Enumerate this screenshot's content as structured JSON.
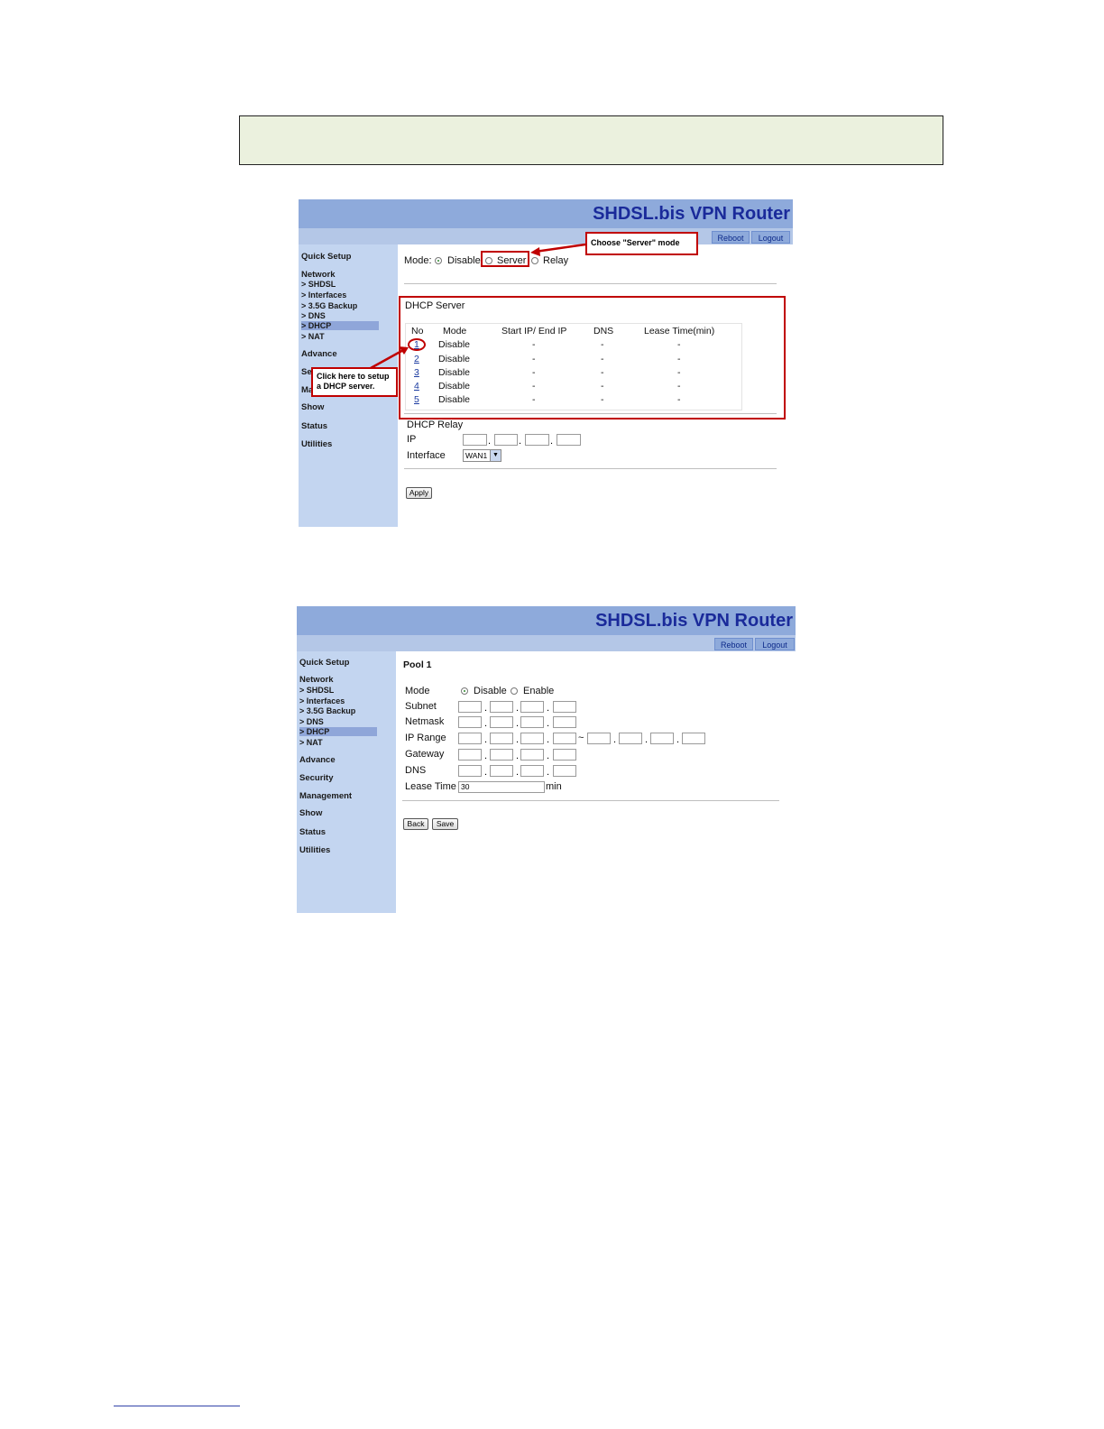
{
  "brand_title": "SHDSL.bis VPN Router",
  "header_buttons": {
    "reboot": "Reboot",
    "logout": "Logout"
  },
  "sidebar_top": "Quick Setup",
  "sidebar_network": "Network",
  "sidebar_sub": [
    "> SHDSL",
    "> Interfaces",
    "> 3.5G Backup",
    "> DNS",
    "> DHCP",
    "> NAT"
  ],
  "sidebar_lower": [
    "Advance",
    "Security",
    "Management",
    "Show",
    "Status",
    "Utilities"
  ],
  "shot1": {
    "sidebar_lower_visible": [
      "Advance",
      "Se",
      "Ma",
      "Show",
      "Status",
      "Utilities"
    ],
    "mode_label": "Mode:",
    "mode_options": [
      "Disable",
      "Server",
      "Relay"
    ],
    "mode_selected": "Disable",
    "server_section_title": "DHCP Server",
    "table_headers": [
      "No",
      "Mode",
      "Start IP/ End IP",
      "DNS",
      "Lease Time(min)"
    ],
    "rows": [
      {
        "no": "1",
        "mode": "Disable",
        "ip": "-",
        "dns": "-",
        "lease": "-"
      },
      {
        "no": "2",
        "mode": "Disable",
        "ip": "-",
        "dns": "-",
        "lease": "-"
      },
      {
        "no": "3",
        "mode": "Disable",
        "ip": "-",
        "dns": "-",
        "lease": "-"
      },
      {
        "no": "4",
        "mode": "Disable",
        "ip": "-",
        "dns": "-",
        "lease": "-"
      },
      {
        "no": "5",
        "mode": "Disable",
        "ip": "-",
        "dns": "-",
        "lease": "-"
      }
    ],
    "relay_title": "DHCP Relay",
    "relay_ip_label": "IP",
    "relay_interface_label": "Interface",
    "relay_interface_value": "WAN1",
    "apply_label": "Apply",
    "callout_server": "Choose \"Server\" mode",
    "callout_row": "Click here to setup a DHCP server."
  },
  "shot2": {
    "pool_title": "Pool 1",
    "mode_label": "Mode",
    "mode_options": [
      "Disable",
      "Enable"
    ],
    "mode_selected": "Disable",
    "fields": [
      "Subnet",
      "Netmask",
      "IP Range",
      "Gateway",
      "DNS"
    ],
    "lease_label": "Lease Time",
    "lease_value": "30",
    "lease_unit": "min",
    "range_sep": "~",
    "back_label": "Back",
    "save_label": "Save"
  },
  "colors": {
    "banner": "#8eaadb",
    "sidebar": "#c3d5f0",
    "brand_text": "#1a2a9a",
    "callout_red": "#c00000",
    "note_bg": "#ebf1de"
  }
}
